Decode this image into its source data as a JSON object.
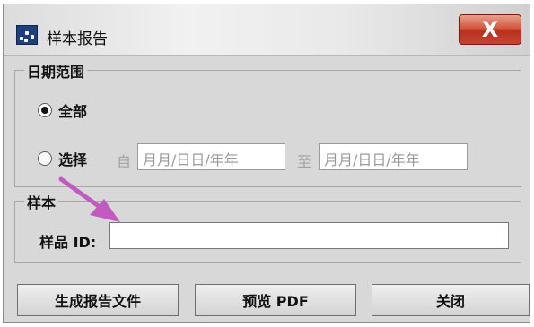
{
  "window": {
    "title": "样本报告",
    "close_label": "X"
  },
  "date_range": {
    "legend": "日期范围",
    "all_label": "全部",
    "select_label": "选择",
    "from_label": "自",
    "to_label": "至",
    "from_placeholder": "月月/日日/年年",
    "to_placeholder": "月月/日日/年年",
    "selected": "全部"
  },
  "sample": {
    "legend": "样本",
    "sample_id_label": "样品 ID:",
    "sample_id_value": ""
  },
  "buttons": {
    "generate": "生成报告文件",
    "preview": "预览 PDF",
    "close": "关闭"
  },
  "annotation": {
    "arrow_color": "#c25bbf"
  }
}
